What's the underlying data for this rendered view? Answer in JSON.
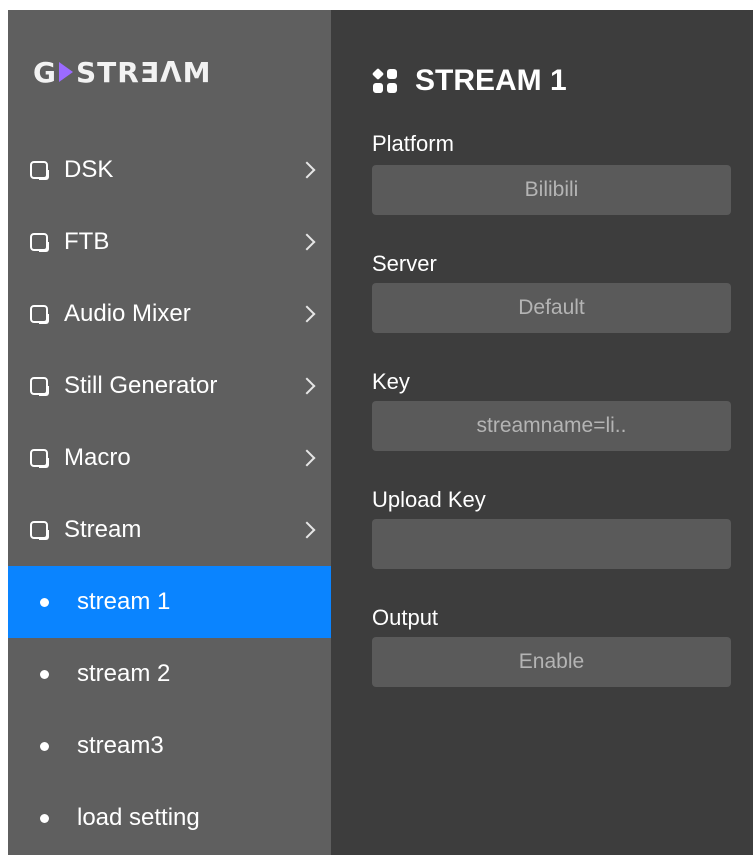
{
  "logo": {
    "text_left": "G",
    "text_right": "STRƎΛM"
  },
  "sidebar": {
    "items": [
      {
        "label": "DSK"
      },
      {
        "label": "FTB"
      },
      {
        "label": "Audio Mixer"
      },
      {
        "label": "Still Generator"
      },
      {
        "label": "Macro"
      },
      {
        "label": "Stream"
      }
    ],
    "sub_items": [
      {
        "label": "stream 1",
        "active": true
      },
      {
        "label": "stream 2",
        "active": false
      },
      {
        "label": "stream3",
        "active": false
      },
      {
        "label": "load setting",
        "active": false
      }
    ]
  },
  "panel": {
    "title": "STREAM 1",
    "fields": {
      "platform": {
        "label": "Platform",
        "value": "Bilibili"
      },
      "server": {
        "label": "Server",
        "value": "Default"
      },
      "key": {
        "label": "Key",
        "value": "streamname=li.."
      },
      "upload_key": {
        "label": "Upload Key",
        "value": ""
      },
      "output": {
        "label": "Output",
        "value": "Enable"
      }
    }
  },
  "colors": {
    "sidebar_bg": "#5f5f5f",
    "panel_bg": "#3d3d3d",
    "field_bg": "#5a5a5a",
    "active_bg": "#0a84ff",
    "logo_accent": "#9b6bff"
  },
  "icons": {
    "menu_item": "square-icon",
    "menu_chevron": "chevron-right-icon",
    "sub_item": "dot-icon",
    "panel_title": "grid-icon"
  }
}
